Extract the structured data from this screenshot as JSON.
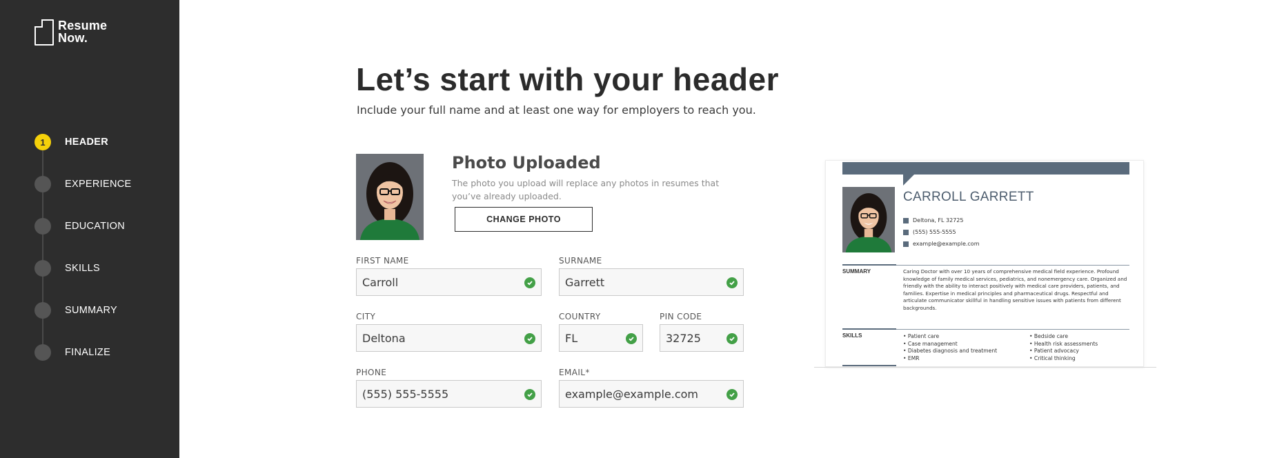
{
  "brand": {
    "line1": "Resume",
    "line2": "Now."
  },
  "steps": [
    {
      "number": "1",
      "label": "HEADER",
      "active": true
    },
    {
      "number": "",
      "label": "EXPERIENCE",
      "active": false
    },
    {
      "number": "",
      "label": "EDUCATION",
      "active": false
    },
    {
      "number": "",
      "label": "SKILLS",
      "active": false
    },
    {
      "number": "",
      "label": "SUMMARY",
      "active": false
    },
    {
      "number": "",
      "label": "FINALIZE",
      "active": false
    }
  ],
  "page": {
    "title": "Let’s start with your header",
    "subtitle": "Include your full name and at least one way for employers to reach you."
  },
  "photo": {
    "title": "Photo Uploaded",
    "description": "The photo you upload will replace any photos in resumes that you’ve already uploaded.",
    "button": "CHANGE PHOTO"
  },
  "form": {
    "first_name": {
      "label": "FIRST NAME",
      "value": "Carroll"
    },
    "surname": {
      "label": "SURNAME",
      "value": "Garrett"
    },
    "city": {
      "label": "CITY",
      "value": "Deltona"
    },
    "country": {
      "label": "COUNTRY",
      "value": "FL"
    },
    "pin_code": {
      "label": "PIN CODE",
      "value": "32725"
    },
    "phone": {
      "label": "PHONE",
      "value": "(555) 555-5555"
    },
    "email": {
      "label": "EMAIL*",
      "value": "example@example.com"
    }
  },
  "preview": {
    "name": "CARROLL GARRETT",
    "address": "Deltona, FL 32725",
    "phone": "(555) 555-5555",
    "email": "example@example.com",
    "summary_heading": "SUMMARY",
    "summary_text": "Caring Doctor with over 10 years of comprehensive medical field experience. Profound knowledge of family medical services, pediatrics, and nonemergency care. Organized and friendly with the ability to interact positively with medical care providers, patients, and families. Expertise in medical principles and pharmaceutical drugs. Respectful and articulate communicator skillful in handling sensitive issues with patients from different backgrounds.",
    "skills_heading": "SKILLS",
    "skills_left": [
      "Patient care",
      "Case management",
      "Diabetes diagnosis and treatment",
      "EMR"
    ],
    "skills_right": [
      "Bedside care",
      "Health risk assessments",
      "Patient advocacy",
      "Critical thinking"
    ]
  },
  "colors": {
    "sidebar": "#2d2d2d",
    "active_step": "#f5d10a",
    "check": "#43a047",
    "resume_accent": "#5a6b7c"
  }
}
